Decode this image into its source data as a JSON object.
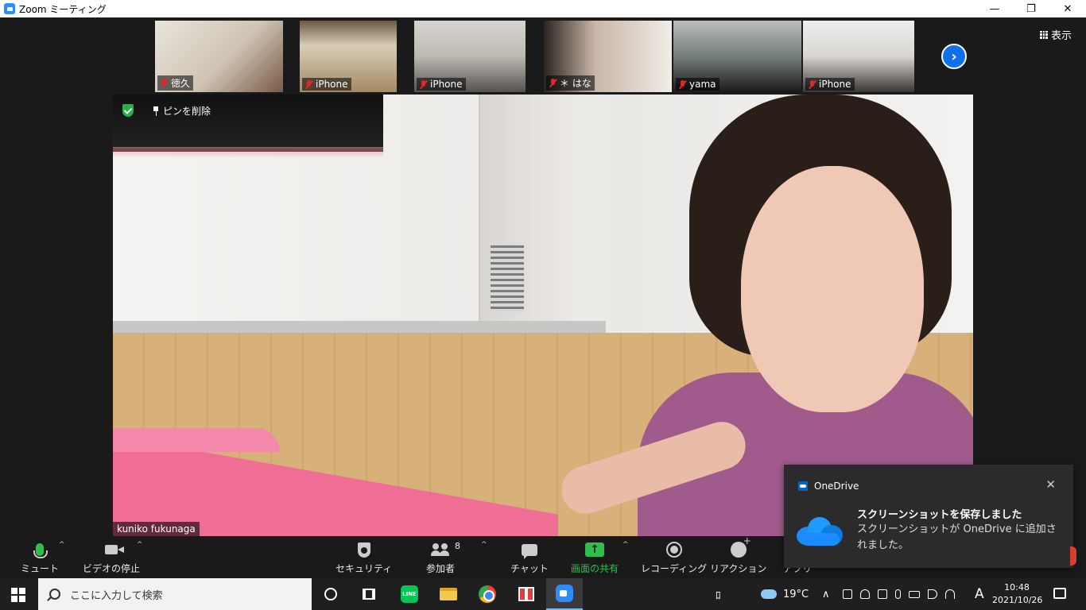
{
  "window": {
    "title": "Zoom ミーティング",
    "minimize": "—",
    "restore": "❐",
    "close": "✕"
  },
  "gallery": {
    "thumbnails": [
      {
        "name": "徳久",
        "muted": true,
        "bg": "#cfc4b4"
      },
      {
        "name": "iPhone",
        "muted": true,
        "bg": "#a48a62"
      },
      {
        "name": "iPhone",
        "muted": true,
        "bg": "#9a9690"
      },
      {
        "name": "＊ はな",
        "muted": true,
        "bg": "#c9b6a8"
      },
      {
        "name": "yama",
        "muted": true,
        "bg": "#6c7572"
      },
      {
        "name": "iPhone",
        "muted": true,
        "bg": "#d9d6d2"
      }
    ],
    "next_icon": "›",
    "view_label": "表示"
  },
  "main_video": {
    "unpin_label": "ピンを削除",
    "participant_name": "kuniko fukunaga"
  },
  "toolbar": {
    "mute_label": "ミュート",
    "video_label": "ビデオの停止",
    "security_label": "セキュリティ",
    "participants_label": "参加者",
    "participants_count": "8",
    "chat_label": "チャット",
    "share_label": "画面の共有",
    "record_label": "レコーディング",
    "reactions_label": "リアクション",
    "apps_label": "アプリ",
    "caret": "^"
  },
  "toast": {
    "app_name": "OneDrive",
    "title": "スクリーンショットを保存しました",
    "message": "スクリーンショットが OneDrive に追加されました。",
    "close": "✕"
  },
  "taskbar": {
    "search_placeholder": "ここに入力して検索",
    "line_label": "LINE",
    "temperature": "19°C",
    "ime": "A",
    "time": "10:48",
    "date": "2021/10/26",
    "tray_up": "∧",
    "person_icon": "ﾛ"
  },
  "colors": {
    "zoom_blue": "#2d8cff",
    "mute_red": "#e02828",
    "active_green": "#2fbf4f",
    "toolbar_bg": "#1a1a1a"
  }
}
